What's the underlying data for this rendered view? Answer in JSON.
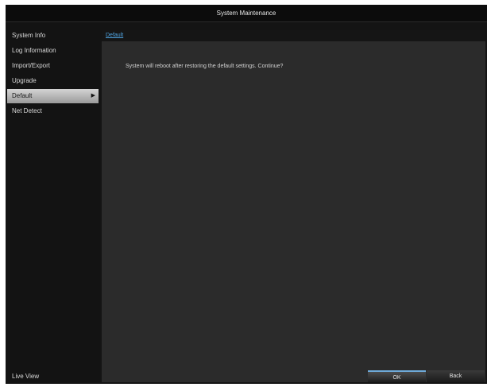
{
  "window": {
    "title": "System Maintenance"
  },
  "sidebar": {
    "items": [
      {
        "label": "System Info",
        "selected": false
      },
      {
        "label": "Log Information",
        "selected": false
      },
      {
        "label": "Import/Export",
        "selected": false
      },
      {
        "label": "Upgrade",
        "selected": false
      },
      {
        "label": "Default",
        "selected": true
      },
      {
        "label": "Net Detect",
        "selected": false
      }
    ],
    "selected_indicator_icon": "chevron-right-icon",
    "live_view_label": "Live View"
  },
  "main": {
    "tab_label": "Default",
    "message": "System will reboot after restoring the default settings. Continue?"
  },
  "buttons": {
    "ok_label": "OK",
    "back_label": "Back"
  },
  "colors": {
    "background": "#141414",
    "panel": "#2b2b2b",
    "accent": "#4fa3e0"
  }
}
